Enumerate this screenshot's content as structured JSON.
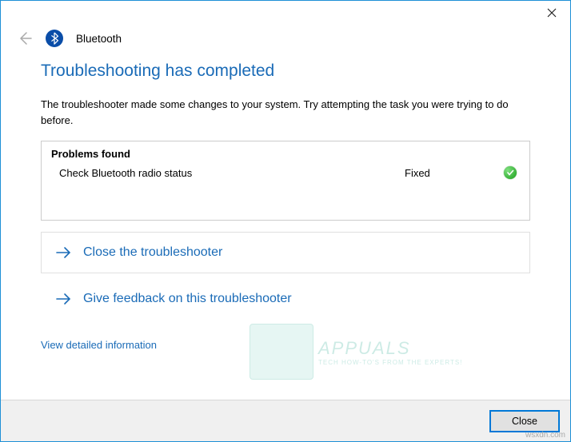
{
  "header": {
    "title": "Bluetooth"
  },
  "main": {
    "heading": "Troubleshooting has completed",
    "description": "The troubleshooter made some changes to your system. Try attempting the task you were trying to do before."
  },
  "problems": {
    "header": "Problems found",
    "items": [
      {
        "name": "Check Bluetooth radio status",
        "status": "Fixed"
      }
    ]
  },
  "actions": {
    "close_troubleshooter": "Close the troubleshooter",
    "give_feedback": "Give feedback on this troubleshooter",
    "view_detail": "View detailed information"
  },
  "footer": {
    "close_button": "Close"
  },
  "watermark": {
    "brand": "APPUALS",
    "tagline": "TECH HOW-TO'S FROM THE EXPERTS!"
  },
  "attribution": "wsxdn.com"
}
